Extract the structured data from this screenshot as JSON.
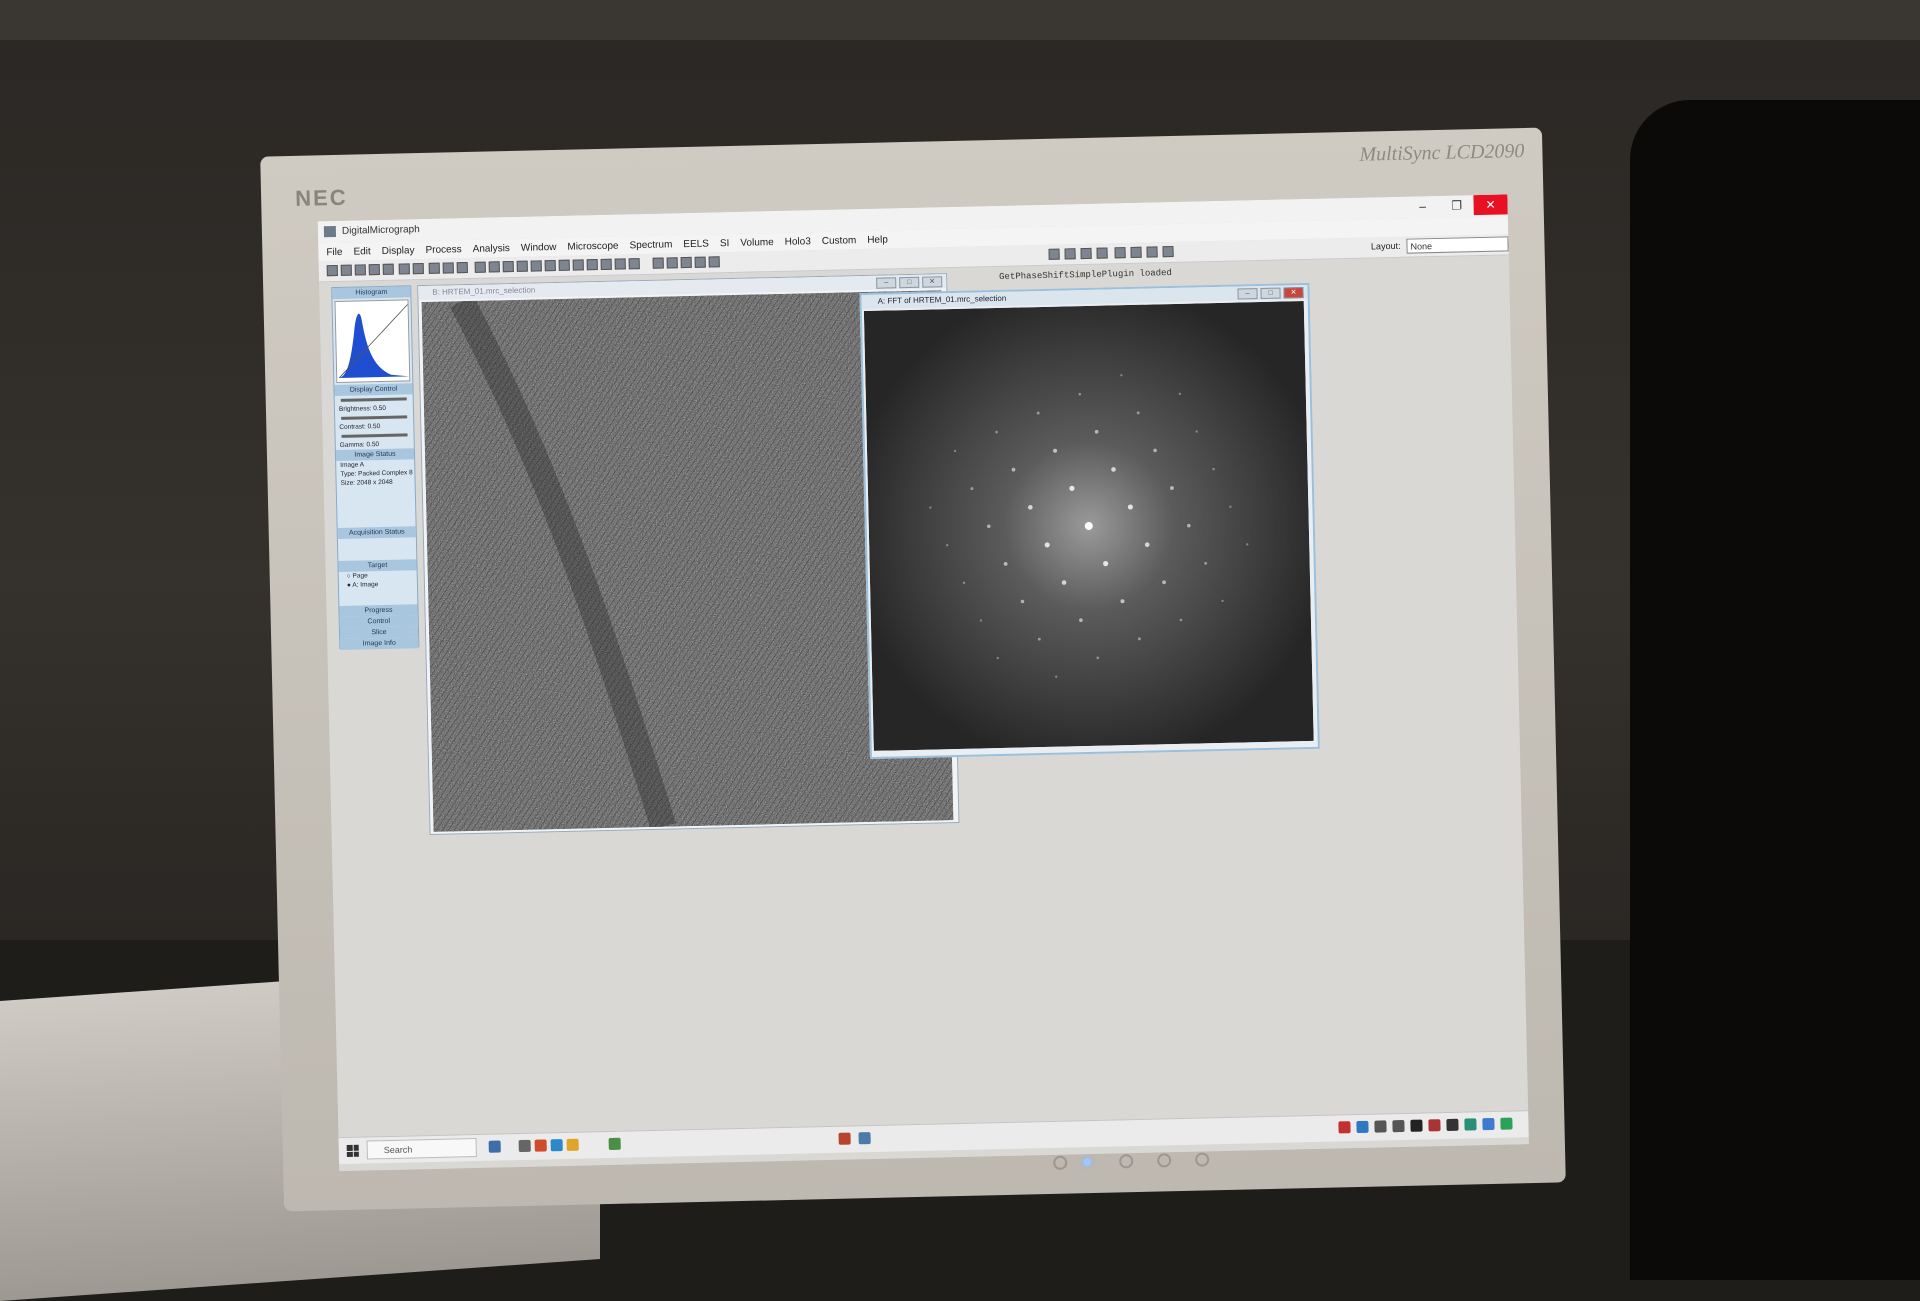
{
  "monitor": {
    "brand": "NEC",
    "model": "MultiSync LCD2090"
  },
  "app": {
    "title": "DigitalMicrograph",
    "window_buttons": [
      "–",
      "❐",
      "✕"
    ]
  },
  "menu": [
    "File",
    "Edit",
    "Display",
    "Process",
    "Analysis",
    "Window",
    "Microscope",
    "Spectrum",
    "EELS",
    "SI",
    "Volume",
    "Holo3",
    "Custom",
    "Help"
  ],
  "toolbar": {
    "layout_label": "Layout:",
    "layout_value": "None"
  },
  "panels": {
    "histogram_title": "Histogram",
    "display_control_title": "Display Control",
    "brightness": "Brightness: 0.50",
    "contrast": "Contrast: 0.50",
    "gamma": "Gamma: 0.50",
    "image_status_title": "Image Status",
    "image_label": "Image A",
    "image_type": "Type: Packed Complex 8",
    "image_size": "Size: 2048 x 2048",
    "acquisition_status_title": "Acquisition Status",
    "target_title": "Target",
    "target_page": "Page",
    "target_image": "A: Image",
    "progress_title": "Progress",
    "control_title": "Control",
    "slice_title": "Slice",
    "image_info_title": "Image Info"
  },
  "image_window": {
    "title": "B: HRTEM_01.mrc_selection"
  },
  "fft_window": {
    "title": "A: FFT of HRTEM_01.mrc_selection"
  },
  "log": {
    "message": "GetPhaseShiftSimplePlugin loaded"
  },
  "taskbar": {
    "search_placeholder": "Search"
  },
  "colors": {
    "histogram_fill": "#1f4fd0",
    "panel_header": "#a9c6df",
    "close_red": "#e81123"
  }
}
